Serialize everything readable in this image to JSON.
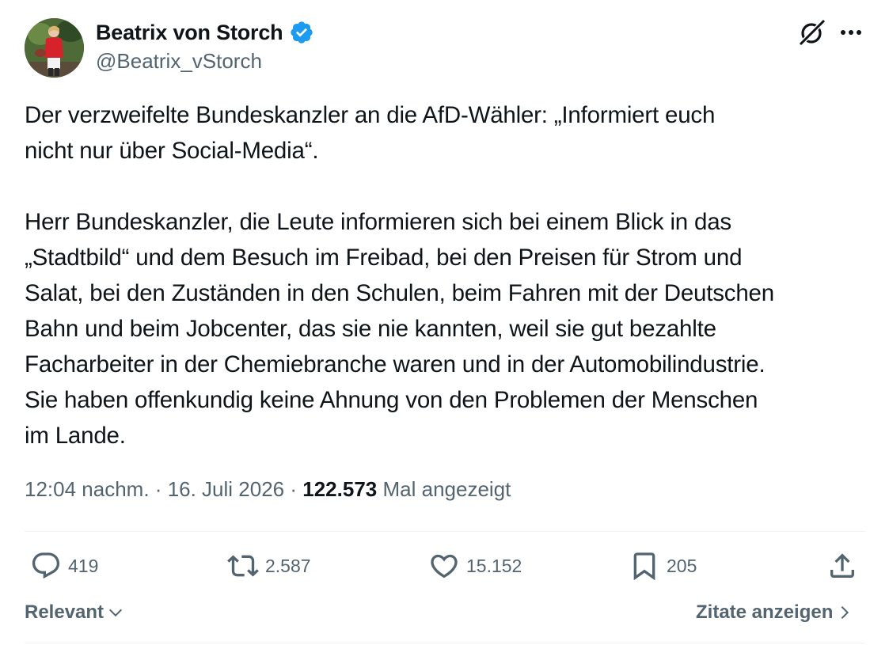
{
  "author": {
    "name": "Beatrix von Storch",
    "handle": "@Beatrix_vStorch",
    "verified": true
  },
  "icons": {
    "verified": "verified-badge-icon",
    "grok": "grok-icon",
    "more": "more-options-icon",
    "reply": "reply-icon",
    "repost": "repost-icon",
    "like": "like-icon",
    "bookmark": "bookmark-icon",
    "share": "share-icon"
  },
  "tweet": {
    "text": "Der verzweifelte Bundeskanzler an die AfD-Wähler: „Informiert euch\nnicht nur über Social-Media“.\n\nHerr Bundeskanzler, die Leute informieren sich bei einem Blick in das\n„Stadtbild“ und dem Besuch im Freibad, bei den Preisen für Strom und\nSalat, bei den Zuständen in den Schulen, beim Fahren mit der Deutschen\nBahn und beim Jobcenter, das sie nie kannten, weil sie gut bezahlte\nFacharbeiter in der Chemiebranche waren und in der Automobilindustrie.\nSie haben offenkundig keine Ahnung von den Problemen der Menschen\nim Lande.",
    "time": "12:04 nachm.",
    "date": "16. Juli 2026",
    "views": "122.573",
    "views_label": "Mal angezeigt"
  },
  "actions": {
    "replies": "419",
    "reposts": "2.587",
    "likes": "15.152",
    "bookmarks": "205"
  },
  "footer": {
    "sort_label": "Relevant",
    "quotes_label": "Zitate anzeigen"
  },
  "colors": {
    "text": "#0f1419",
    "secondary": "#536471",
    "verified": "#1d9bf0",
    "divider": "#eff3f4"
  }
}
